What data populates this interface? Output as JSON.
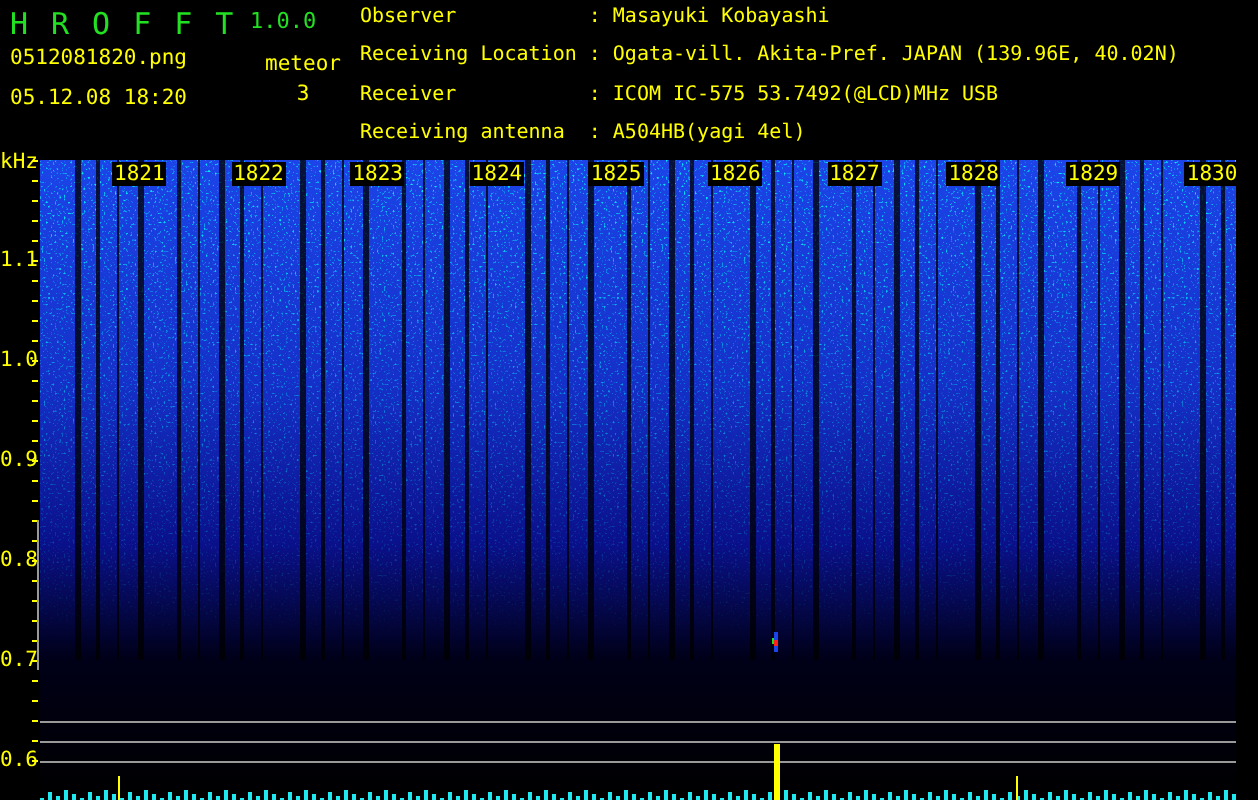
{
  "header": {
    "title": "HROFFT",
    "version": "1.0.0",
    "filename": "0512081820.png",
    "datetime": "05.12.08 18:20",
    "meteor_label": "meteor",
    "meteor_count": "3"
  },
  "info": [
    {
      "label": "Observer",
      "value": "Masayuki Kobayashi"
    },
    {
      "label": "Receiving Location",
      "value": "Ogata-vill. Akita-Pref. JAPAN (139.96E, 40.02N)"
    },
    {
      "label": "Receiver",
      "value": "ICOM IC-575 53.7492(@LCD)MHz USB"
    },
    {
      "label": "Receiving antenna",
      "value": "A504HB(yagi 4el)"
    }
  ],
  "info_separator": ":",
  "spectrogram": {
    "y_unit": "kHz",
    "y_labels": [
      "1.1",
      "1.0",
      "0.9",
      "0.8",
      "0.7",
      "0.6"
    ],
    "time_labels": [
      "1821",
      "1822",
      "1823",
      "1824",
      "1825",
      "1826",
      "1827",
      "1828",
      "1829",
      "1830"
    ]
  }
}
